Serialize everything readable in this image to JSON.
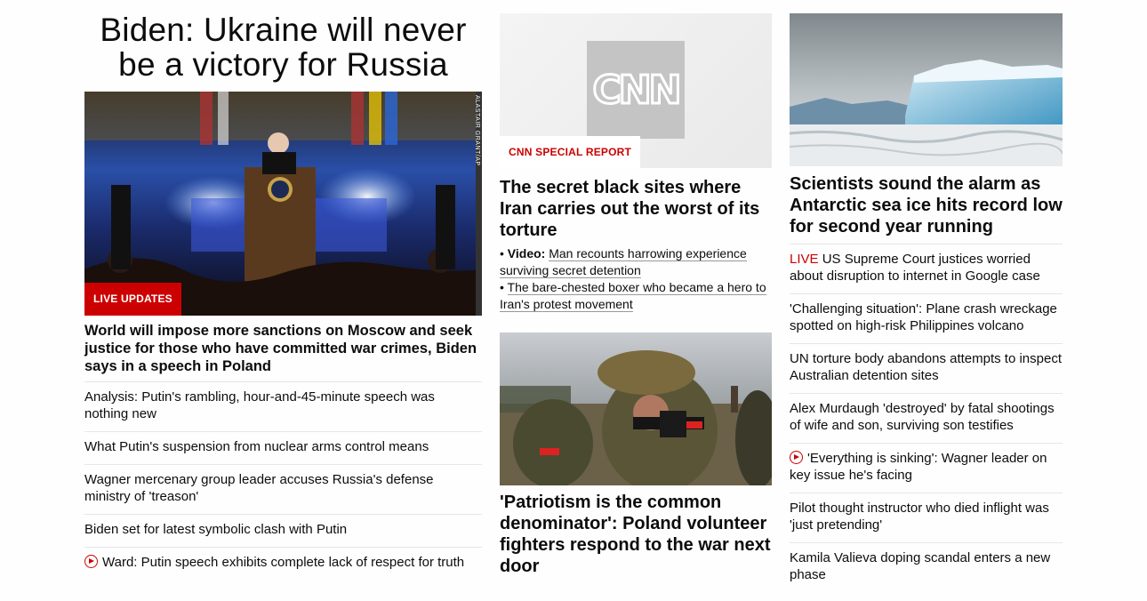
{
  "col1": {
    "hero_title": "Biden: Ukraine will never be a victory for Russia",
    "hero_badge": "LIVE UPDATES",
    "hero_credit": "ALASTAIR GRANT/AP",
    "headline": "World will impose more sanctions on Moscow and seek justice for those who have committed war crimes, Biden says in a speech in Poland",
    "links": [
      "Analysis: Putin's rambling, hour-and-45-minute speech was nothing new",
      "What Putin's suspension from nuclear arms control means",
      "Wagner mercenary group leader accuses Russia's defense ministry of 'treason'",
      "Biden set for latest symbolic clash with Putin",
      "Ward: Putin speech exhibits complete lack of respect for truth"
    ]
  },
  "col2": {
    "logo_text": "CNN",
    "badge": "CNN SPECIAL REPORT",
    "headline": "The secret black sites where Iran carries out the worst of its torture",
    "sub1_prefix": "• ",
    "sub1_label": "Video:",
    "sub1_text": "Man recounts harrowing experience surviving secret detention",
    "sub2_prefix": "• ",
    "sub2_text": "The bare-chested boxer who became a hero to Iran's protest movement",
    "headline2": "'Patriotism is the common denominator': Poland volunteer fighters respond to the war next door"
  },
  "col3": {
    "headline": "Scientists sound the alarm as Antarctic sea ice hits record low for second year running",
    "live_label": "LIVE",
    "links": [
      "US Supreme Court justices worried about disruption to internet in Google case",
      "'Challenging situation': Plane crash wreckage spotted on high-risk Philippines volcano",
      "UN torture body abandons attempts to inspect Australian detention sites",
      "Alex Murdaugh 'destroyed' by fatal shootings of wife and son, surviving son testifies",
      "'Everything is sinking': Wagner leader on key issue he's facing",
      "Pilot thought instructor who died inflight was 'just pretending'",
      "Kamila Valieva doping scandal enters a new phase"
    ]
  },
  "colors": {
    "accent_red": "#cc0000",
    "text": "#0c0c0c",
    "divider": "#e6e6e6"
  }
}
